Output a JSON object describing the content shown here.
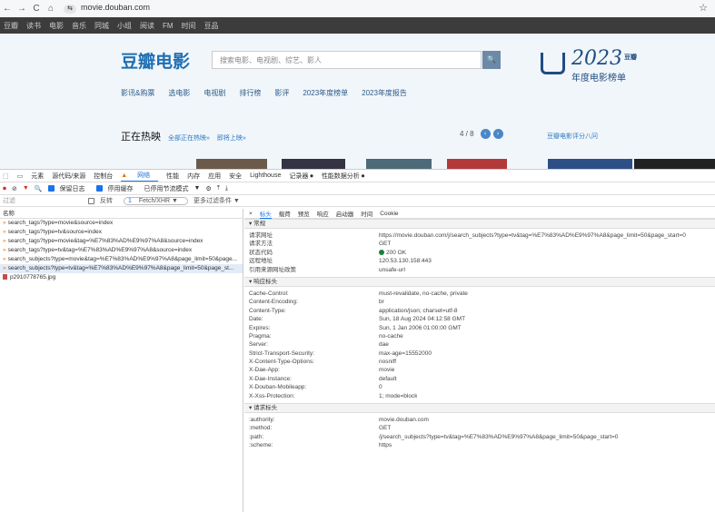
{
  "browser": {
    "url": "movie.douban.com",
    "back": "←",
    "forward": "→",
    "reload": "C",
    "home": "⌂",
    "tune": "⇆",
    "bookmark": "☆"
  },
  "top_nav": [
    "豆瓣",
    "读书",
    "电影",
    "音乐",
    "同城",
    "小组",
    "阅读",
    "FM",
    "时间",
    "豆品"
  ],
  "site": {
    "logo": "豆瓣电影",
    "search_placeholder": "搜索电影、电视剧、综艺、影人",
    "search_icon": "🔍",
    "subnav": [
      "影讯&购票",
      "选电影",
      "电视剧",
      "排行榜",
      "影评",
      "2023年度榜单",
      "2023年度报告"
    ],
    "year_badge": {
      "year": "2023",
      "tag": "豆瓣",
      "subtitle": "年度电影榜单"
    },
    "hot": {
      "title": "正在热映",
      "link_all": "全部正在热映»",
      "link_upcoming": "即将上映»"
    },
    "pager": {
      "text": "4 / 8",
      "prev": "‹",
      "next": "›"
    },
    "rank_link": "豆瓣电影评分八问"
  },
  "devtools": {
    "tabs": [
      "元素",
      "源代码/来源",
      "控制台",
      "网络",
      "性能",
      "内存",
      "应用",
      "安全",
      "Lighthouse",
      "记录器 ⏺",
      "性能数据分析 ⏺"
    ],
    "active_tab": "网络",
    "tab_icons": {
      "inspect": "⬚",
      "device": "▭"
    },
    "toolbar": {
      "preserve_log": "保留日志",
      "disable_cache": "停用缓存",
      "throttle": "已停用节流模式",
      "throttle_caret": "▼",
      "record": "⏺",
      "clear": "⊘",
      "filter_icon": "▼",
      "search_icon": "🔍",
      "wifi_icon": "⚙",
      "upload": "⤒",
      "download": "⤓"
    },
    "filter": {
      "placeholder": "过滤",
      "invert": "反转",
      "fetch_count": "1",
      "fetch_label": "Fetch/XHR ▼",
      "more": "更多过滤条件 ▼"
    },
    "list_header": "名称",
    "requests": [
      {
        "name": "search_tags?type=movie&source=index",
        "selected": false,
        "kind": "xhr"
      },
      {
        "name": "search_tags?type=tv&source=index",
        "selected": false,
        "kind": "xhr"
      },
      {
        "name": "search_tags?type=movie&tag=%E7%83%AD%E9%97%A8&source=index",
        "selected": false,
        "kind": "xhr"
      },
      {
        "name": "search_tags?type=tv&tag=%E7%83%AD%E9%97%A8&source=index",
        "selected": false,
        "kind": "xhr"
      },
      {
        "name": "search_subjects?type=movie&tag=%E7%83%AD%E9%97%A8&page_limit=50&page...",
        "selected": false,
        "kind": "xhr"
      },
      {
        "name": "search_subjects?type=tv&tag=%E7%83%AD%E9%97%A8&page_limit=50&page_st...",
        "selected": true,
        "kind": "xhr"
      },
      {
        "name": "p2910778765.jpg",
        "selected": false,
        "kind": "img"
      }
    ],
    "detail_tabs": [
      "×",
      "标头",
      "载荷",
      "预览",
      "响应",
      "启动器",
      "时间",
      "Cookie"
    ],
    "detail_active": "标头",
    "general": {
      "title": "常规",
      "rows": [
        {
          "k": "请求网址",
          "v": "https://movie.douban.com/j/search_subjects?type=tv&tag=%E7%83%AD%E9%97%A8&page_limit=50&page_start=0"
        },
        {
          "k": "请求方法",
          "v": "GET"
        },
        {
          "k": "状态代码",
          "v": "200 OK"
        },
        {
          "k": "远程地址",
          "v": "120.53.130.158:443"
        },
        {
          "k": "引用来源网址政策",
          "v": "unsafe-url"
        }
      ]
    },
    "response_headers": {
      "title": "响应标头",
      "rows": [
        {
          "k": "Cache-Control:",
          "v": "must-revalidate, no-cache, private"
        },
        {
          "k": "Content-Encoding:",
          "v": "br"
        },
        {
          "k": "Content-Type:",
          "v": "application/json; charset=utf-8"
        },
        {
          "k": "Date:",
          "v": "Sun, 18 Aug 2024 04:12:58 GMT"
        },
        {
          "k": "Expires:",
          "v": "Sun, 1 Jan 2006 01:00:00 GMT"
        },
        {
          "k": "Pragma:",
          "v": "no-cache"
        },
        {
          "k": "Server:",
          "v": "dae"
        },
        {
          "k": "Strict-Transport-Security:",
          "v": "max-age=15552000"
        },
        {
          "k": "X-Content-Type-Options:",
          "v": "nosniff"
        },
        {
          "k": "X-Dae-App:",
          "v": "movie"
        },
        {
          "k": "X-Dae-Instance:",
          "v": "default"
        },
        {
          "k": "X-Douban-Mobileapp:",
          "v": "0"
        },
        {
          "k": "X-Xss-Protection:",
          "v": "1; mode=block"
        }
      ]
    },
    "request_headers": {
      "title": "请求标头",
      "rows": [
        {
          "k": ":authority:",
          "v": "movie.douban.com"
        },
        {
          "k": ":method:",
          "v": "GET"
        },
        {
          "k": ":path:",
          "v": "/j/search_subjects?type=tv&tag=%E7%83%AD%E9%97%A8&page_limit=50&page_start=0"
        },
        {
          "k": ":scheme:",
          "v": "https"
        }
      ]
    },
    "colors": {
      "accent": "#1a73e8",
      "selected_row": "#e2ebf8",
      "status_ok": "#188038",
      "xhr_icon": "#e37400"
    }
  }
}
